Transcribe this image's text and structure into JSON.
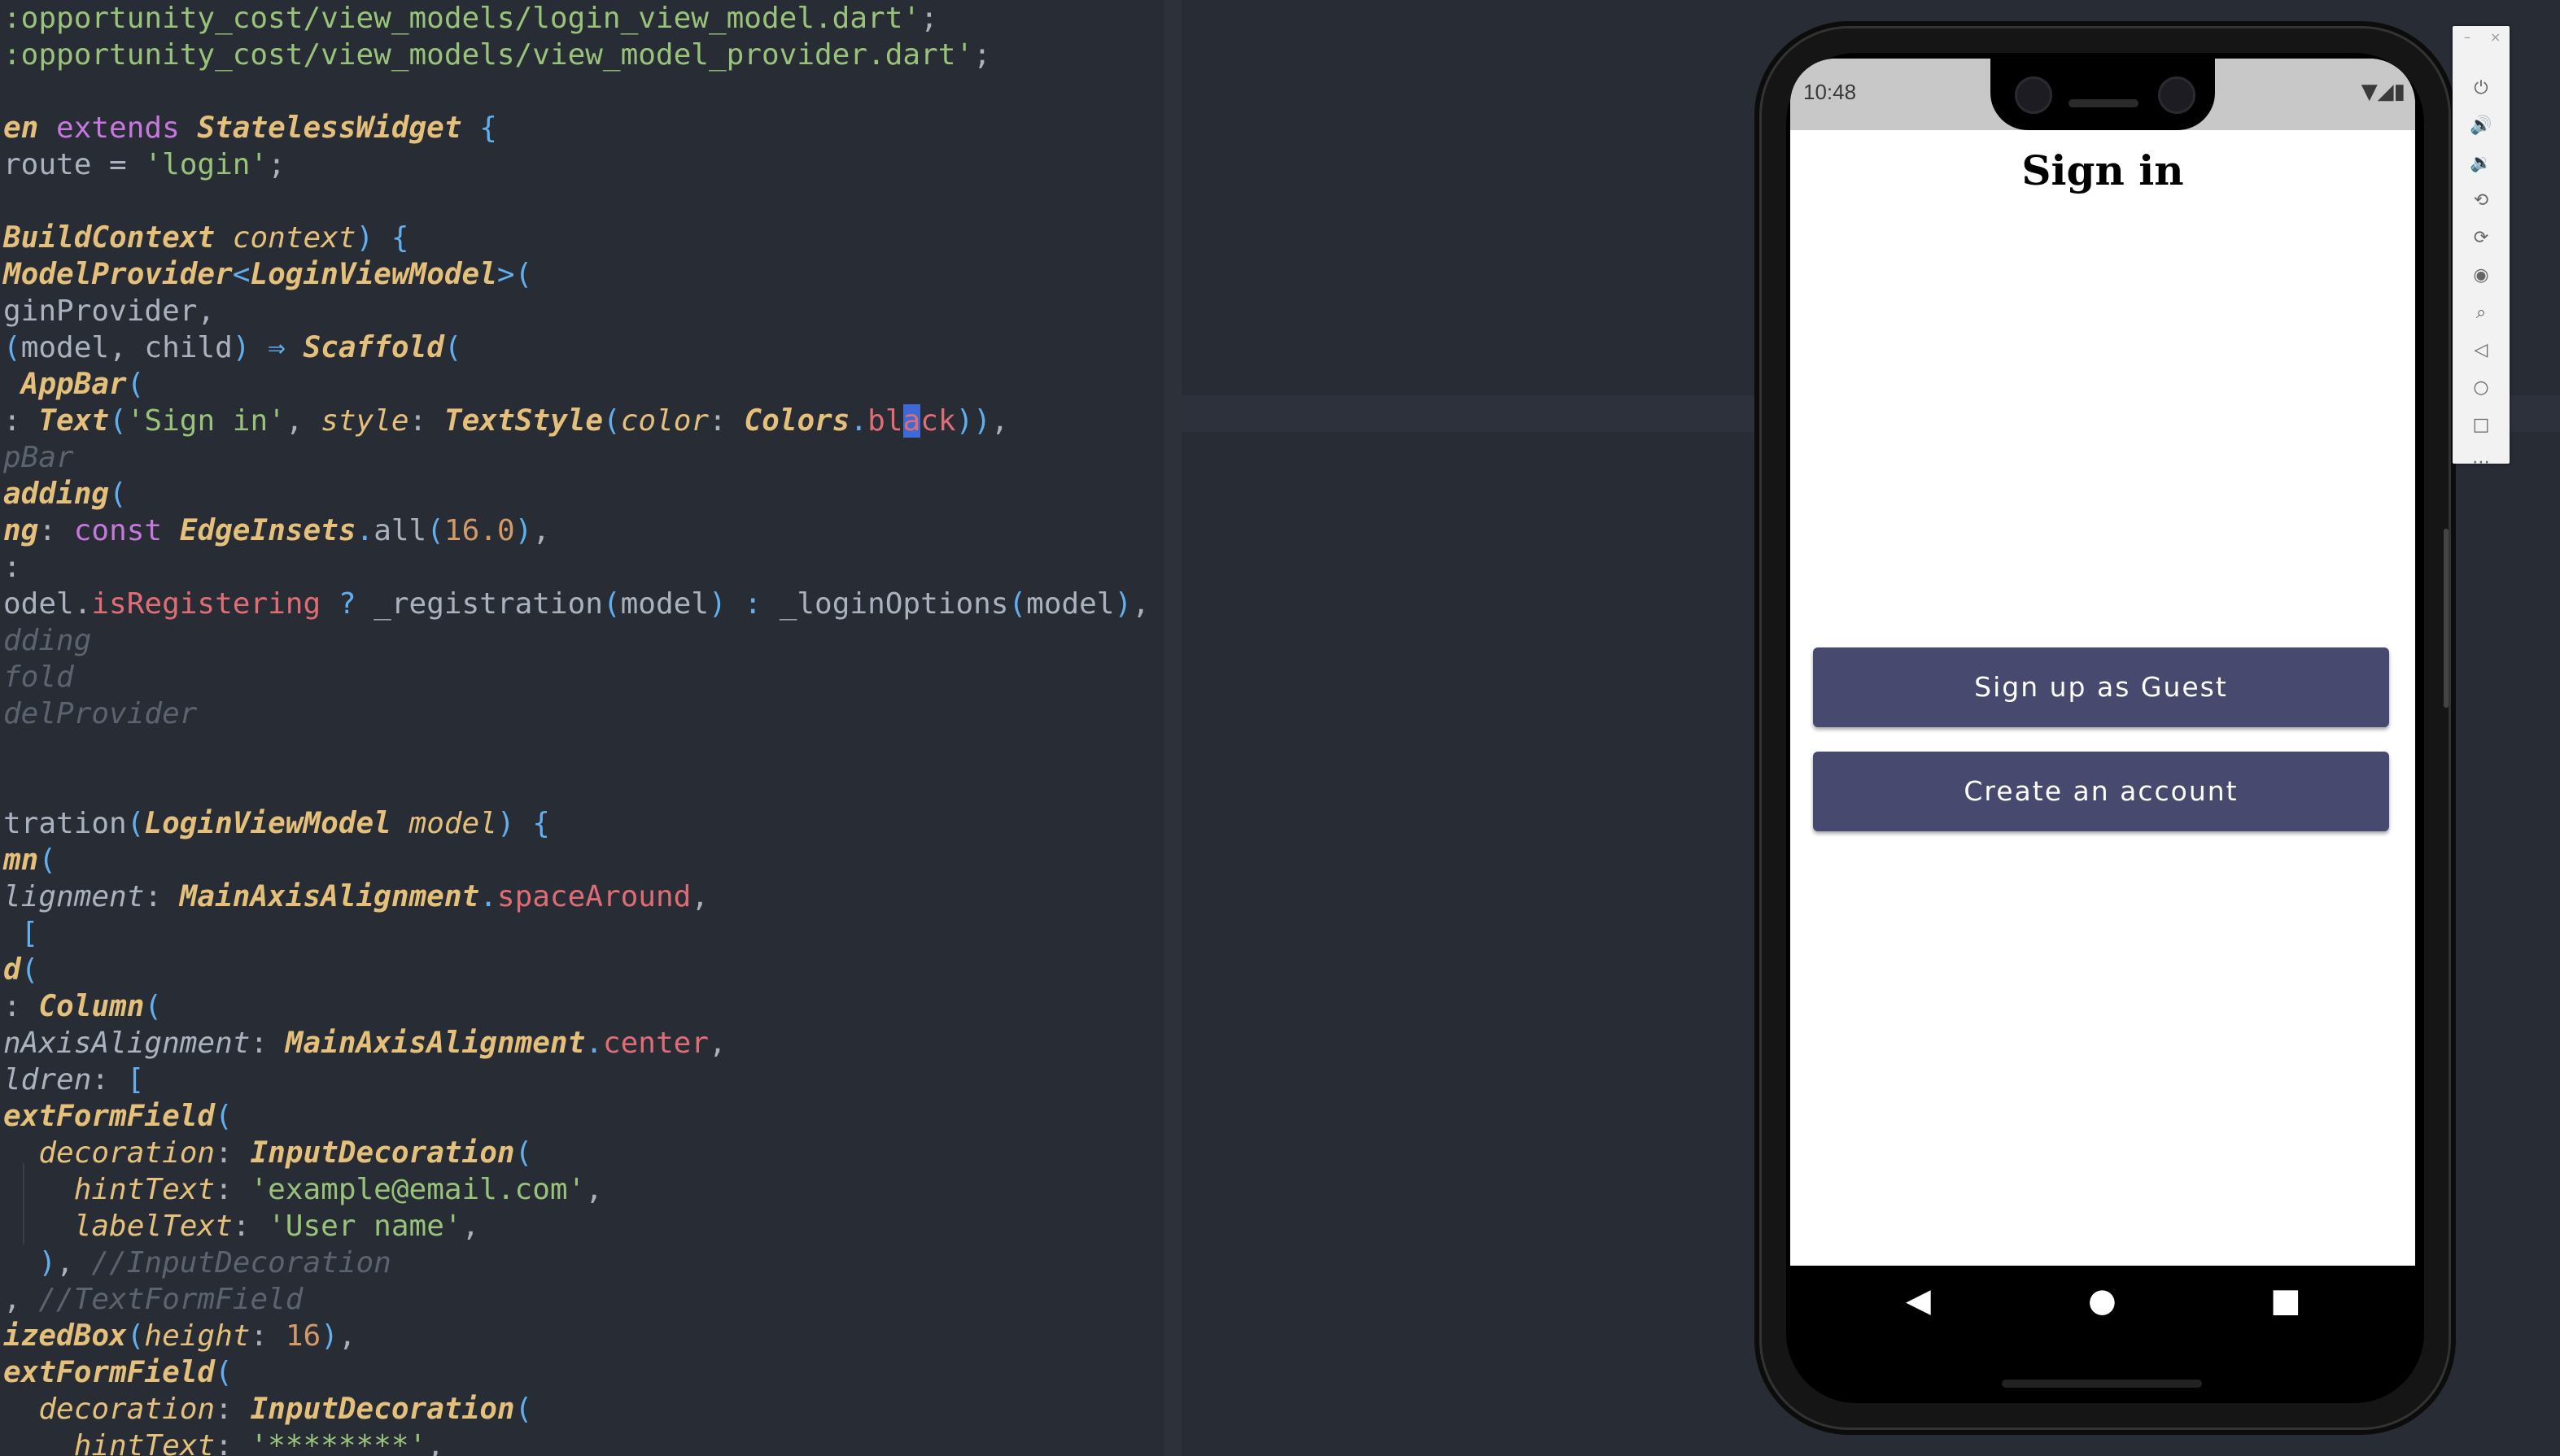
{
  "editor": {
    "lines": [
      [
        {
          "c": "st",
          "t": ":opportunity_cost/view_models/login_view_model.dart'"
        },
        {
          "c": "pl",
          "t": ";"
        }
      ],
      [
        {
          "c": "st",
          "t": ":opportunity_cost/view_models/view_model_provider.dart'"
        },
        {
          "c": "pl",
          "t": ";"
        }
      ],
      [],
      [
        {
          "c": "ty",
          "t": "en "
        },
        {
          "c": "kw",
          "t": "extends "
        },
        {
          "c": "ty",
          "t": "StatelessWidget "
        },
        {
          "c": "pn",
          "t": "{"
        }
      ],
      [
        {
          "c": "pl",
          "t": "route = "
        },
        {
          "c": "st",
          "t": "'login'"
        },
        {
          "c": "pl",
          "t": ";"
        }
      ],
      [],
      [
        {
          "c": "ty",
          "t": "BuildContext "
        },
        {
          "c": "ag",
          "t": "context"
        },
        {
          "c": "pn",
          "t": ") {"
        }
      ],
      [
        {
          "c": "ty",
          "t": "ModelProvider"
        },
        {
          "c": "pn",
          "t": "<"
        },
        {
          "c": "ty",
          "t": "LoginViewModel"
        },
        {
          "c": "pn",
          "t": ">("
        }
      ],
      [
        {
          "c": "pl",
          "t": "ginProvider,"
        }
      ],
      [
        {
          "c": "pn",
          "t": "("
        },
        {
          "c": "pl",
          "t": "model, child"
        },
        {
          "c": "pn",
          "t": ") ⇒ "
        },
        {
          "c": "ty",
          "t": "Scaffold"
        },
        {
          "c": "pn",
          "t": "("
        }
      ],
      [
        {
          "c": "ty",
          "t": " AppBar"
        },
        {
          "c": "pn",
          "t": "("
        }
      ],
      [
        {
          "c": "pl",
          "t": ": "
        },
        {
          "c": "ty",
          "t": "Text"
        },
        {
          "c": "pn",
          "t": "("
        },
        {
          "c": "st",
          "t": "'Sign in'"
        },
        {
          "c": "pl",
          "t": ", "
        },
        {
          "c": "ag",
          "t": "style"
        },
        {
          "c": "pl",
          "t": ": "
        },
        {
          "c": "ty",
          "t": "TextStyle"
        },
        {
          "c": "pn",
          "t": "("
        },
        {
          "c": "ag",
          "t": "color"
        },
        {
          "c": "pl",
          "t": ": "
        },
        {
          "c": "ty",
          "t": "Colors"
        },
        {
          "c": "pn",
          "t": "."
        },
        {
          "c": "pr",
          "t": "bl"
        },
        {
          "c": "cursor",
          "t": "a"
        },
        {
          "c": "pr",
          "t": "ck"
        },
        {
          "c": "pn",
          "t": "))"
        },
        {
          "c": "pl",
          "t": ","
        }
      ],
      [
        {
          "c": "cm",
          "t": "pBar"
        }
      ],
      [
        {
          "c": "ty",
          "t": "adding"
        },
        {
          "c": "pn",
          "t": "("
        }
      ],
      [
        {
          "c": "ty",
          "t": "ng"
        },
        {
          "c": "pl",
          "t": ": "
        },
        {
          "c": "kw",
          "t": "const "
        },
        {
          "c": "ty",
          "t": "EdgeInsets"
        },
        {
          "c": "pn",
          "t": "."
        },
        {
          "c": "pl",
          "t": "all"
        },
        {
          "c": "pn",
          "t": "("
        },
        {
          "c": "nm",
          "t": "16.0"
        },
        {
          "c": "pn",
          "t": ")"
        },
        {
          "c": "pl",
          "t": ","
        }
      ],
      [
        {
          "c": "pl",
          "t": ":"
        }
      ],
      [
        {
          "c": "pl",
          "t": "odel."
        },
        {
          "c": "pr",
          "t": "isRegistering "
        },
        {
          "c": "pn",
          "t": "? "
        },
        {
          "c": "pl",
          "t": "_registration"
        },
        {
          "c": "pn",
          "t": "("
        },
        {
          "c": "pl",
          "t": "model"
        },
        {
          "c": "pn",
          "t": ") : "
        },
        {
          "c": "pl",
          "t": "_loginOptions"
        },
        {
          "c": "pn",
          "t": "("
        },
        {
          "c": "pl",
          "t": "model"
        },
        {
          "c": "pn",
          "t": ")"
        },
        {
          "c": "pl",
          "t": ","
        }
      ],
      [
        {
          "c": "cm",
          "t": "dding"
        }
      ],
      [
        {
          "c": "cm",
          "t": "fold"
        }
      ],
      [
        {
          "c": "cm",
          "t": "delProvider"
        }
      ],
      [],
      [],
      [
        {
          "c": "pl",
          "t": "tration"
        },
        {
          "c": "pn",
          "t": "("
        },
        {
          "c": "ty",
          "t": "LoginViewModel "
        },
        {
          "c": "ag",
          "t": "model"
        },
        {
          "c": "pn",
          "t": ") {"
        }
      ],
      [
        {
          "c": "ty",
          "t": "mn"
        },
        {
          "c": "pn",
          "t": "("
        }
      ],
      [
        {
          "c": "pi",
          "t": "lignment"
        },
        {
          "c": "pl",
          "t": ": "
        },
        {
          "c": "ty",
          "t": "MainAxisAlignment"
        },
        {
          "c": "pn",
          "t": "."
        },
        {
          "c": "pr",
          "t": "spaceAround"
        },
        {
          "c": "pl",
          "t": ","
        }
      ],
      [
        {
          "c": "pn",
          "t": " ["
        }
      ],
      [
        {
          "c": "ty",
          "t": "d"
        },
        {
          "c": "pn",
          "t": "("
        }
      ],
      [
        {
          "c": "pl",
          "t": ": "
        },
        {
          "c": "ty",
          "t": "Column"
        },
        {
          "c": "pn",
          "t": "("
        }
      ],
      [
        {
          "c": "pi",
          "t": "nAxisAlignment"
        },
        {
          "c": "pl",
          "t": ": "
        },
        {
          "c": "ty",
          "t": "MainAxisAlignment"
        },
        {
          "c": "pn",
          "t": "."
        },
        {
          "c": "pr",
          "t": "center"
        },
        {
          "c": "pl",
          "t": ","
        }
      ],
      [
        {
          "c": "pi",
          "t": "ldren"
        },
        {
          "c": "pl",
          "t": ": "
        },
        {
          "c": "pn",
          "t": "["
        }
      ],
      [
        {
          "c": "ty",
          "t": "extFormField"
        },
        {
          "c": "pn",
          "t": "("
        }
      ],
      [
        {
          "c": "ag",
          "t": "  decoration"
        },
        {
          "c": "pl",
          "t": ": "
        },
        {
          "c": "ty",
          "t": "InputDecoration"
        },
        {
          "c": "pn",
          "t": "("
        }
      ],
      [
        {
          "c": "ag",
          "t": "    hintText"
        },
        {
          "c": "pl",
          "t": ": "
        },
        {
          "c": "st",
          "t": "'example@email.com'"
        },
        {
          "c": "pl",
          "t": ","
        }
      ],
      [
        {
          "c": "ag",
          "t": "    labelText"
        },
        {
          "c": "pl",
          "t": ": "
        },
        {
          "c": "st",
          "t": "'User name'"
        },
        {
          "c": "pl",
          "t": ","
        }
      ],
      [
        {
          "c": "pn",
          "t": "  )"
        },
        {
          "c": "pl",
          "t": ", "
        },
        {
          "c": "cm",
          "t": "//InputDecoration"
        }
      ],
      [
        {
          "c": "pl",
          "t": ", "
        },
        {
          "c": "cm",
          "t": "//TextFormField"
        }
      ],
      [
        {
          "c": "ty",
          "t": "izedBox"
        },
        {
          "c": "pn",
          "t": "("
        },
        {
          "c": "ag",
          "t": "height"
        },
        {
          "c": "pl",
          "t": ": "
        },
        {
          "c": "nm",
          "t": "16"
        },
        {
          "c": "pn",
          "t": ")"
        },
        {
          "c": "pl",
          "t": ","
        }
      ],
      [
        {
          "c": "ty",
          "t": "extFormField"
        },
        {
          "c": "pn",
          "t": "("
        }
      ],
      [
        {
          "c": "ag",
          "t": "  decoration"
        },
        {
          "c": "pl",
          "t": ": "
        },
        {
          "c": "ty",
          "t": "InputDecoration"
        },
        {
          "c": "pn",
          "t": "("
        }
      ],
      [
        {
          "c": "ag",
          "t": "    hintText"
        },
        {
          "c": "pl",
          "t": ": "
        },
        {
          "c": "st",
          "t": "'********'"
        },
        {
          "c": "pl",
          "t": ","
        }
      ]
    ]
  },
  "device": {
    "status_time": "10:48",
    "status_icons": "▼◢▮",
    "app_title": "Sign in",
    "buttons": [
      "Sign up as Guest",
      "Create an account"
    ],
    "nav": {
      "back": "◀",
      "home": "●",
      "recents": "■"
    }
  },
  "emulator_toolbar": {
    "window_controls": [
      "–",
      "×"
    ],
    "icons": [
      "power-icon",
      "volume-up-icon",
      "volume-down-icon",
      "rotate-left-icon",
      "rotate-right-icon",
      "camera-icon",
      "zoom-icon",
      "back-icon",
      "home-icon",
      "overview-icon",
      "more-icon"
    ],
    "glyphs": [
      "⏻",
      "🔊",
      "🔉",
      "⟲",
      "⟳",
      "◉",
      "⌕",
      "◁",
      "○",
      "□",
      "⋯"
    ]
  },
  "colors": {
    "editor_bg": "#282c34",
    "button_bg": "#474a6e",
    "keyword": "#c678dd",
    "type": "#e5c07b",
    "string": "#98c379"
  }
}
